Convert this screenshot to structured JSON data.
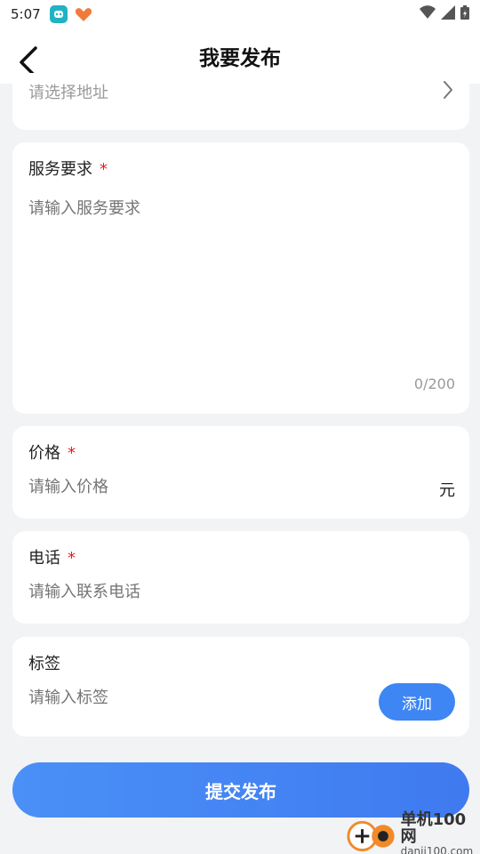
{
  "status_bar": {
    "time": "5:07"
  },
  "nav": {
    "title": "我要发布"
  },
  "address": {
    "placeholder": "请选择地址"
  },
  "service": {
    "label": "服务要求",
    "required": "*",
    "placeholder": "请输入服务要求",
    "counter": "0/200"
  },
  "price": {
    "label": "价格",
    "required": "*",
    "placeholder": "请输入价格",
    "unit": "元"
  },
  "phone": {
    "label": "电话",
    "required": "*",
    "placeholder": "请输入联系电话"
  },
  "tags": {
    "label": "标签",
    "placeholder": "请输入标签",
    "add_label": "添加"
  },
  "submit": {
    "label": "提交发布"
  },
  "watermark": {
    "title": "单机100网",
    "url": "danji100.com"
  },
  "colors": {
    "accent": "#3d86f3",
    "required": "#e02020",
    "background": "#f2f3f5"
  }
}
